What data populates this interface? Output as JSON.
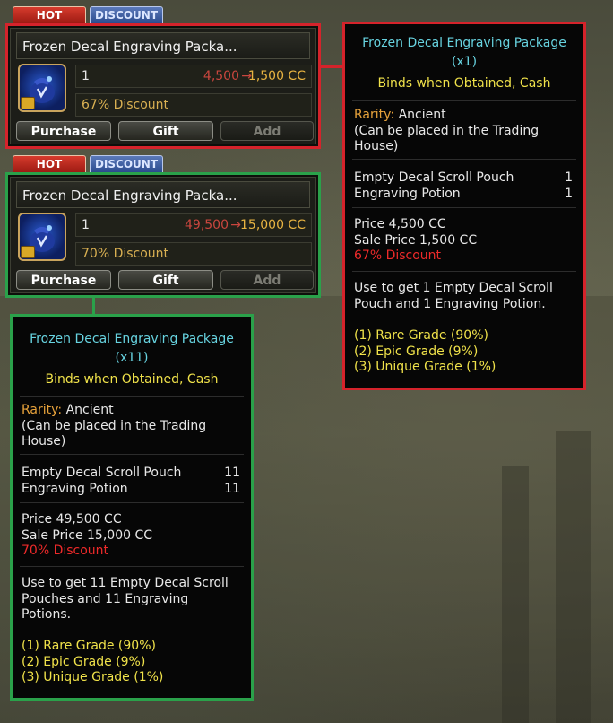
{
  "colors": {
    "highlight_red": "#d5232b",
    "highlight_green": "#2aa14a",
    "title_cyan": "#67d3e0",
    "bind_yellow": "#f0e24a"
  },
  "items": [
    {
      "tags": {
        "hot": "HOT",
        "discount": "DISCOUNT"
      },
      "name": "Frozen Decal Engraving Packa...",
      "icon": "decal-pouch-icon",
      "quantity": "1",
      "price_old": "4,500",
      "price_new": "1,500 CC",
      "discount": "67% Discount",
      "buttons": {
        "purchase": "Purchase",
        "gift": "Gift",
        "add": "Add"
      }
    },
    {
      "tags": {
        "hot": "HOT",
        "discount": "DISCOUNT"
      },
      "name": "Frozen Decal Engraving Packa...",
      "icon": "decal-pouch-icon",
      "quantity": "1",
      "price_old": "49,500",
      "price_new": "15,000 CC",
      "discount": "70% Discount",
      "buttons": {
        "purchase": "Purchase",
        "gift": "Gift",
        "add": "Add"
      }
    }
  ],
  "tooltips": [
    {
      "title": "Frozen Decal Engraving Package",
      "count": "(x1)",
      "binds": "Binds when Obtained, Cash",
      "rarity_label": "Rarity:",
      "rarity_value": "Ancient",
      "trade_note_1": "(Can be placed in the Trading",
      "trade_note_2": "House)",
      "contents": [
        {
          "name": "Empty Decal Scroll Pouch",
          "qty": "1"
        },
        {
          "name": "Engraving Potion",
          "qty": "1"
        }
      ],
      "price": "Price 4,500 CC",
      "sale_price": "Sale Price 1,500 CC",
      "discount": "67% Discount",
      "use_1": "Use to get 1 Empty Decal Scroll",
      "use_2": "Pouch and 1 Engraving Potion.",
      "grades": [
        "(1) Rare Grade (90%)",
        "(2) Epic Grade (9%)",
        "(3) Unique Grade (1%)"
      ]
    },
    {
      "title": "Frozen Decal Engraving Package",
      "count": "(x11)",
      "binds": "Binds when Obtained, Cash",
      "rarity_label": "Rarity:",
      "rarity_value": "Ancient",
      "trade_note_1": "(Can be placed in the Trading",
      "trade_note_2": "House)",
      "contents": [
        {
          "name": "Empty Decal Scroll Pouch",
          "qty": "11"
        },
        {
          "name": "Engraving Potion",
          "qty": "11"
        }
      ],
      "price": "Price 49,500 CC",
      "sale_price": "Sale Price 15,000 CC",
      "discount": "70% Discount",
      "use_1": "Use to get 11 Empty Decal Scroll",
      "use_2": "Pouches and 11 Engraving",
      "use_3": "Potions.",
      "grades": [
        "(1) Rare Grade (90%)",
        "(2) Epic Grade (9%)",
        "(3) Unique Grade (1%)"
      ]
    }
  ]
}
